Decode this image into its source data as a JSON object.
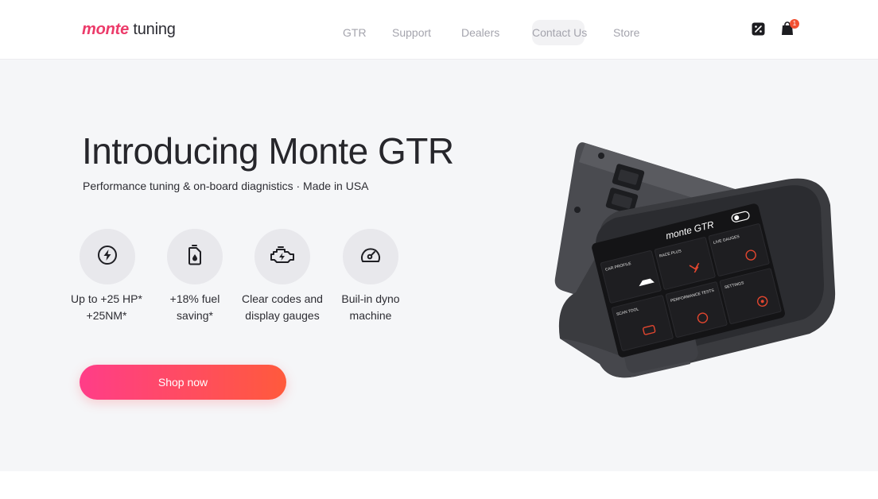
{
  "header": {
    "logo": {
      "brand": "monte",
      "rest": "tuning"
    },
    "nav": [
      {
        "label": "GTR"
      },
      {
        "label": "Support"
      },
      {
        "label": "Dealers"
      },
      {
        "label": "Contact Us"
      },
      {
        "label": "Store"
      }
    ],
    "cart_count": "1",
    "icons": [
      "discount-icon",
      "shopping-bag-icon"
    ]
  },
  "hero": {
    "title": "Introducing Monte GTR",
    "subtitle": "Performance tuning & on-board diagnistics · Made in USA",
    "features": [
      {
        "icon": "bolt-icon",
        "line1": "Up to +25 HP*",
        "line2": "+25NM*"
      },
      {
        "icon": "fuel-can-icon",
        "line1": "+18% fuel",
        "line2": "saving*"
      },
      {
        "icon": "engine-icon",
        "line1": "Clear codes and",
        "line2": "display gauges"
      },
      {
        "icon": "speedometer-icon",
        "line1": "Buil-in dyno",
        "line2": "machine"
      }
    ],
    "cta": "Shop now"
  },
  "device_screen": {
    "brand": "monte GTR",
    "tiles": [
      "CAR PROFILE",
      "RACE PLUS",
      "LIVE GAUGES",
      "SCAN TOOL",
      "PERFORMANCE TESTS",
      "SETTINGS"
    ]
  },
  "colors": {
    "accent_pink": "#ff3d88",
    "accent_orange": "#ff5a3c",
    "hero_bg": "#f5f6f8",
    "device_body": "#3b3c40"
  }
}
